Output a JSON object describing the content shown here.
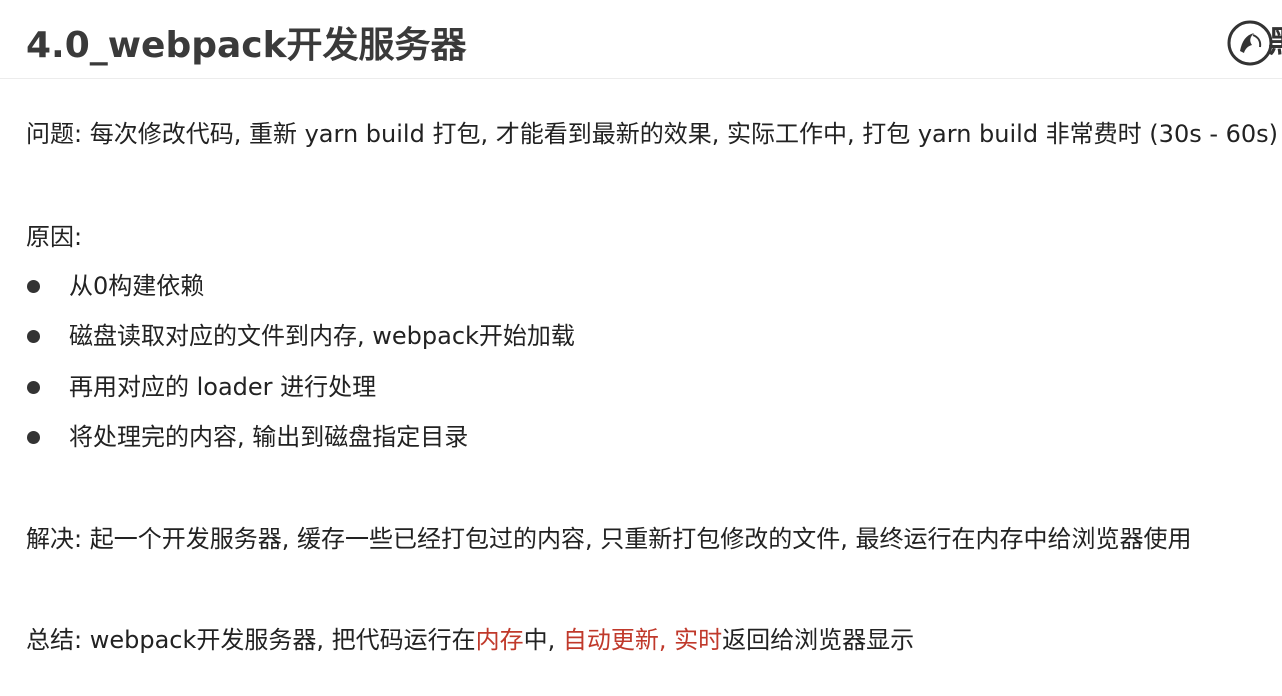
{
  "header": {
    "title": "4.0_webpack开发服务器",
    "logo_char": "黑"
  },
  "problem": {
    "text": "问题: 每次修改代码, 重新 yarn build 打包, 才能看到最新的效果, 实际工作中, 打包 yarn build 非常费时 (30s - 60s)"
  },
  "reason": {
    "heading": "原因:",
    "items": [
      "从0构建依赖",
      "磁盘读取对应的文件到内存, webpack开始加载",
      "再用对应的 loader 进行处理",
      "将处理完的内容, 输出到磁盘指定目录"
    ]
  },
  "solution": {
    "text": "解决: 起一个开发服务器, 缓存一些已经打包过的内容, 只重新打包修改的文件, 最终运行在内存中给浏览器使用"
  },
  "summary": {
    "prefix": "总结: webpack开发服务器, 把代码运行在",
    "highlight1": "内存",
    "middle": "中, ",
    "highlight2": "自动更新, 实时",
    "suffix": "返回给浏览器显示"
  },
  "colors": {
    "highlight": "#c0392b",
    "title": "#3a3a3a"
  }
}
